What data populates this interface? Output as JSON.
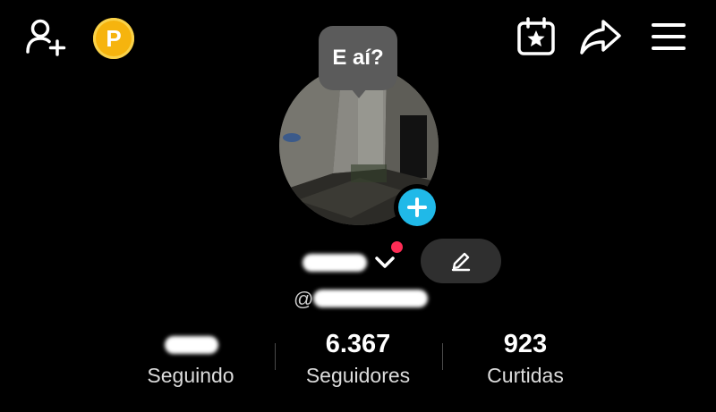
{
  "top_bar": {
    "icons": [
      "add-user-icon",
      "coin-icon",
      "calendar-star-icon",
      "share-icon",
      "menu-icon"
    ],
    "coin_letter": "P"
  },
  "profile": {
    "status_bubble": "E aí?",
    "handle_prefix": "@"
  },
  "stats": {
    "following_label": "Seguindo",
    "followers_value": "6.367",
    "followers_label": "Seguidores",
    "likes_value": "923",
    "likes_label": "Curtidas"
  },
  "colors": {
    "background": "#000000",
    "accent_blue": "#20b9e8",
    "coin": "#f6b40e",
    "notification_red": "#fe2c55",
    "edit_button_bg": "#2f2f2f",
    "bubble_bg": "#5b5b5b"
  }
}
